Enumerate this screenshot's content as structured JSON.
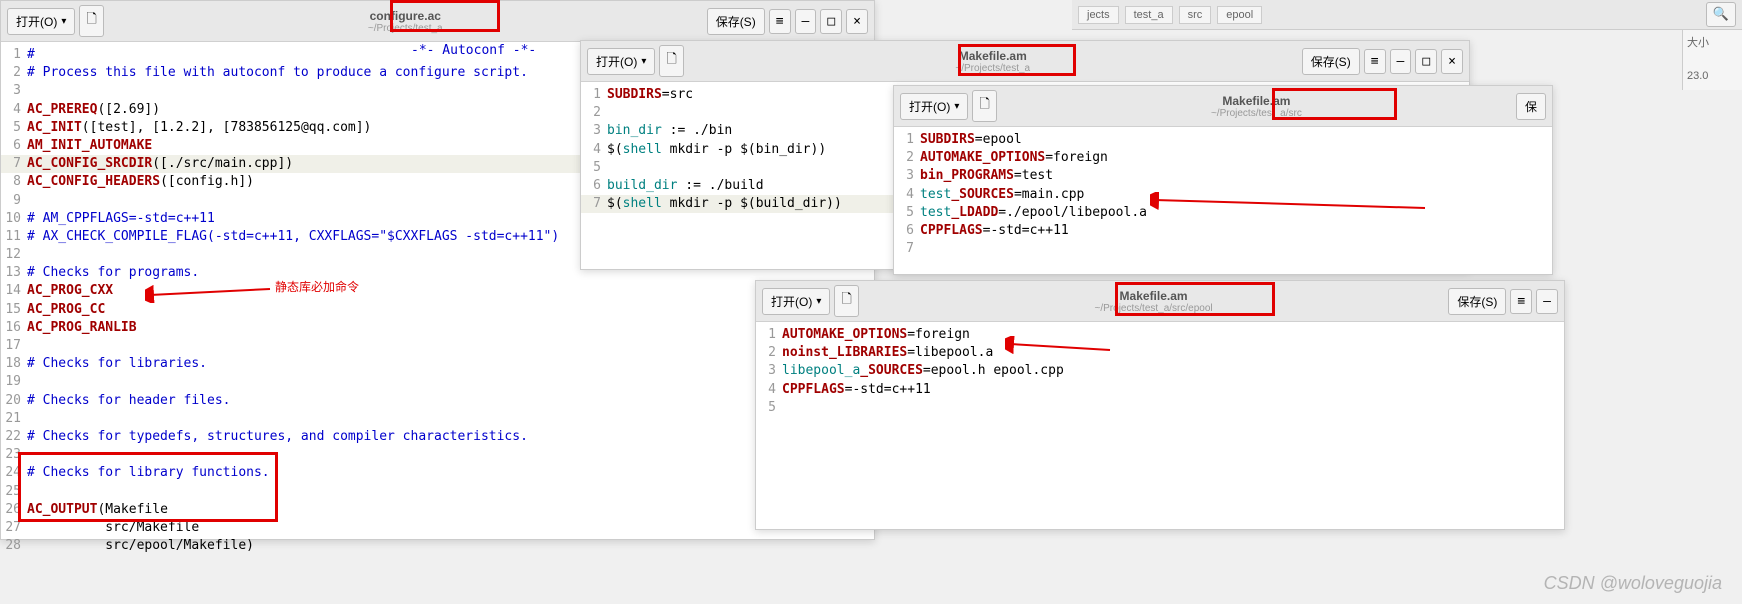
{
  "common": {
    "open_label": "打开(O)",
    "save_label": "保存(S)",
    "save_short": "保"
  },
  "editor1": {
    "title": "configure.ac",
    "path": "~/Projects/test_a",
    "lines": [
      {
        "n": 1,
        "p": [
          {
            "t": "#",
            "c": "cmt"
          }
        ]
      },
      {
        "n": 2,
        "p": [
          {
            "t": "# Process this file with autoconf to produce a configure script.",
            "c": "cmt"
          }
        ]
      },
      {
        "n": 3,
        "p": []
      },
      {
        "n": 4,
        "p": [
          {
            "t": "AC_PREREQ",
            "c": "kw"
          },
          {
            "t": "([2.69])"
          }
        ]
      },
      {
        "n": 5,
        "p": [
          {
            "t": "AC_INIT",
            "c": "kw"
          },
          {
            "t": "([test], [1.2.2], [783856125@qq.com])"
          }
        ]
      },
      {
        "n": 6,
        "p": [
          {
            "t": "AM_INIT_AUTOMAKE",
            "c": "kw"
          }
        ]
      },
      {
        "n": 7,
        "p": [
          {
            "t": "AC_CONFIG_SRCDIR",
            "c": "kw"
          },
          {
            "t": "([./src/main.cpp])"
          }
        ],
        "hl": true
      },
      {
        "n": 8,
        "p": [
          {
            "t": "AC_CONFIG_HEADERS",
            "c": "kw"
          },
          {
            "t": "([config.h])"
          }
        ]
      },
      {
        "n": 9,
        "p": []
      },
      {
        "n": 10,
        "p": [
          {
            "t": "# AM_CPPFLAGS=-std=c++11",
            "c": "cmt"
          }
        ]
      },
      {
        "n": 11,
        "p": [
          {
            "t": "# AX_CHECK_COMPILE_FLAG(-std=c++11, CXXFLAGS=\"$CXXFLAGS -std=c++11\")",
            "c": "cmt"
          }
        ]
      },
      {
        "n": 12,
        "p": []
      },
      {
        "n": 13,
        "p": [
          {
            "t": "# Checks for programs.",
            "c": "cmt"
          }
        ]
      },
      {
        "n": 14,
        "p": [
          {
            "t": "AC_PROG_CXX",
            "c": "kw"
          }
        ]
      },
      {
        "n": 15,
        "p": [
          {
            "t": "AC_PROG_CC",
            "c": "kw"
          }
        ]
      },
      {
        "n": 16,
        "p": [
          {
            "t": "AC_PROG_RANLIB",
            "c": "kw"
          }
        ]
      },
      {
        "n": 17,
        "p": []
      },
      {
        "n": 18,
        "p": [
          {
            "t": "# Checks for libraries.",
            "c": "cmt"
          }
        ]
      },
      {
        "n": 19,
        "p": []
      },
      {
        "n": 20,
        "p": [
          {
            "t": "# Checks for header files.",
            "c": "cmt"
          }
        ]
      },
      {
        "n": 21,
        "p": []
      },
      {
        "n": 22,
        "p": [
          {
            "t": "# Checks for typedefs, structures, and compiler characteristics.",
            "c": "cmt"
          }
        ]
      },
      {
        "n": 23,
        "p": []
      },
      {
        "n": 24,
        "p": [
          {
            "t": "# Checks for library functions.",
            "c": "cmt"
          }
        ]
      },
      {
        "n": 25,
        "p": []
      },
      {
        "n": 26,
        "p": [
          {
            "t": "AC_OUTPUT",
            "c": "kw"
          },
          {
            "t": "(Makefile"
          }
        ]
      },
      {
        "n": 27,
        "p": [
          {
            "t": "          src/Makefile"
          }
        ]
      },
      {
        "n": 28,
        "p": [
          {
            "t": "          src/epool/Makefile)"
          }
        ]
      }
    ],
    "autoconf_tag": "-*- Autoconf -*-",
    "annotation": "静态库必加命令"
  },
  "editor2": {
    "title": "Makefile.am",
    "path": "~/Projects/test_a",
    "lines": [
      {
        "n": 1,
        "p": [
          {
            "t": "SUBDIRS",
            "c": "kw"
          },
          {
            "t": "=src"
          }
        ]
      },
      {
        "n": 2,
        "p": []
      },
      {
        "n": 3,
        "p": [
          {
            "t": "bin_dir",
            "c": "var"
          },
          {
            "t": " := ./bin"
          }
        ]
      },
      {
        "n": 4,
        "p": [
          {
            "t": "$("
          },
          {
            "t": "shell",
            "c": "var"
          },
          {
            "t": " mkdir -p $(bin_dir))"
          }
        ]
      },
      {
        "n": 5,
        "p": []
      },
      {
        "n": 6,
        "p": [
          {
            "t": "build_dir",
            "c": "var"
          },
          {
            "t": " := ./build"
          }
        ]
      },
      {
        "n": 7,
        "p": [
          {
            "t": "$("
          },
          {
            "t": "shell",
            "c": "var"
          },
          {
            "t": " mkdir -p $(build_dir))"
          }
        ],
        "hl": true
      }
    ]
  },
  "editor3": {
    "title": "Makefile.am",
    "path": "~/Projects/test_a/src",
    "lines": [
      {
        "n": 1,
        "p": [
          {
            "t": "SUBDIRS",
            "c": "kw"
          },
          {
            "t": "=epool"
          }
        ]
      },
      {
        "n": 2,
        "p": [
          {
            "t": "AUTOMAKE_OPTIONS",
            "c": "kw"
          },
          {
            "t": "=foreign"
          }
        ]
      },
      {
        "n": 3,
        "p": [
          {
            "t": "bin_PROGRAMS",
            "c": "kw"
          },
          {
            "t": "=test"
          }
        ]
      },
      {
        "n": 4,
        "p": [
          {
            "t": "test",
            "c": "var"
          },
          {
            "t": "_SOURCES",
            "c": "kw"
          },
          {
            "t": "=main.cpp"
          }
        ]
      },
      {
        "n": 5,
        "p": [
          {
            "t": "test",
            "c": "var"
          },
          {
            "t": "_LDADD",
            "c": "kw"
          },
          {
            "t": "=./epool/libepool.a"
          }
        ]
      },
      {
        "n": 6,
        "p": [
          {
            "t": "CPPFLAGS",
            "c": "kw"
          },
          {
            "t": "=-std=c++11"
          }
        ]
      },
      {
        "n": 7,
        "p": []
      }
    ]
  },
  "editor4": {
    "title": "Makefile.am",
    "path": "~/Projects/test_a/src/epool",
    "lines": [
      {
        "n": 1,
        "p": [
          {
            "t": "AUTOMAKE_OPTIONS",
            "c": "kw"
          },
          {
            "t": "=foreign"
          }
        ]
      },
      {
        "n": 2,
        "p": [
          {
            "t": "noinst_LIBRARIES",
            "c": "kw"
          },
          {
            "t": "=libepool.a"
          }
        ]
      },
      {
        "n": 3,
        "p": [
          {
            "t": "libepool_a",
            "c": "var"
          },
          {
            "t": "_SOURCES",
            "c": "kw"
          },
          {
            "t": "=epool.h epool.cpp"
          }
        ]
      },
      {
        "n": 4,
        "p": [
          {
            "t": "CPPFLAGS",
            "c": "kw"
          },
          {
            "t": "=-std=c++11"
          }
        ]
      },
      {
        "n": 5,
        "p": []
      }
    ]
  },
  "topfrag": {
    "tabs": [
      "jects",
      "test_a",
      "src",
      "epool"
    ],
    "size_label": "大小",
    "num": "23.0"
  },
  "watermark": "CSDN @woloveguojia"
}
